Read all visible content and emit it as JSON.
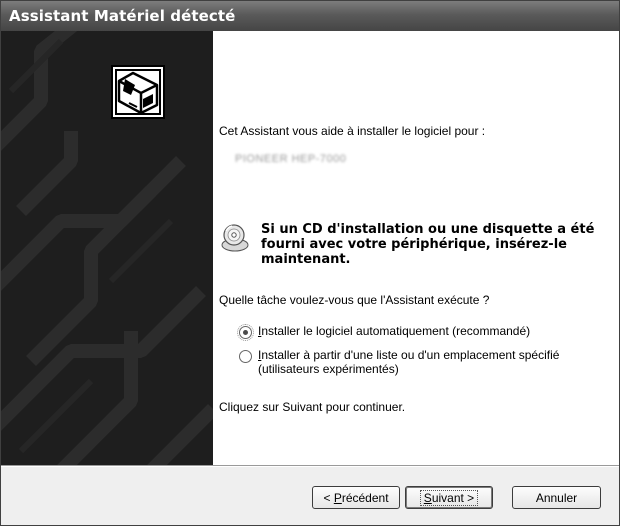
{
  "window": {
    "title": "Assistant Matériel détecté"
  },
  "content": {
    "intro": "Cet Assistant vous aide à installer le logiciel pour :",
    "device_name": "PIONEER HEP-7000",
    "cd_message": "Si un CD d'installation ou une disquette a été fourni avec votre périphérique, insérez-le maintenant.",
    "question": "Quelle tâche voulez-vous que l'Assistant exécute ?",
    "options": [
      {
        "accel": "I",
        "rest": "nstaller le logiciel automatiquement (recommandé)",
        "selected": true
      },
      {
        "accel": "I",
        "rest": "nstaller à partir d'une liste ou d'un emplacement spécifié\n(utilisateurs expérimentés)",
        "selected": false
      }
    ],
    "continue_text": "Cliquez sur Suivant pour continuer."
  },
  "buttons": {
    "back_prefix": "< ",
    "back_accel": "P",
    "back_rest": "récédent",
    "next_accel": "S",
    "next_rest": "uivant >",
    "cancel": "Annuler"
  },
  "icons": {
    "wizard": "hardware-wizard-icon",
    "cd": "cd-disk-icon"
  }
}
